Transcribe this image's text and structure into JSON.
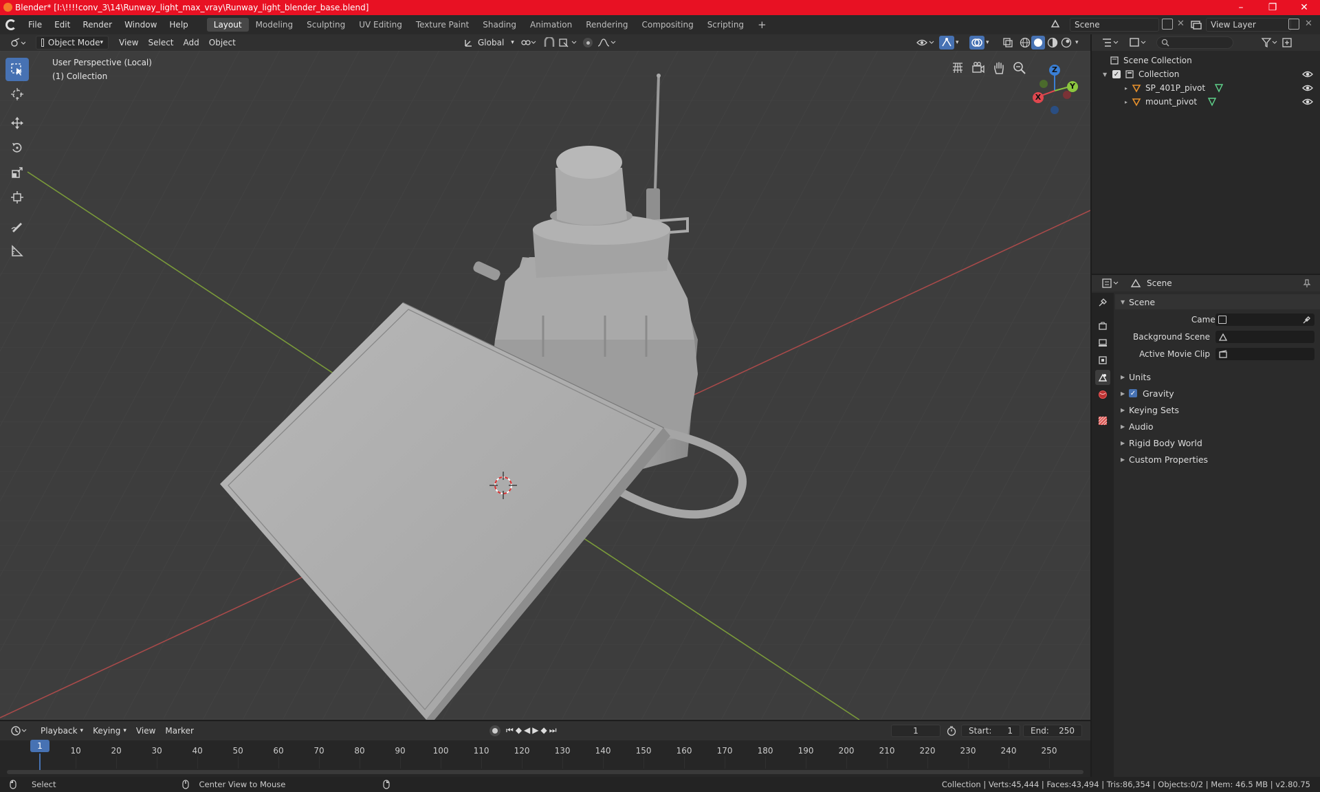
{
  "window": {
    "title": "Blender* [I:\\!!!!conv_3\\14\\Runway_light_max_vray\\Runway_light_blender_base.blend]",
    "minimize": "–",
    "maximize": "❐",
    "close": "✕"
  },
  "menu": [
    "File",
    "Edit",
    "Render",
    "Window",
    "Help"
  ],
  "workspaces": [
    "Layout",
    "Modeling",
    "Sculpting",
    "UV Editing",
    "Texture Paint",
    "Shading",
    "Animation",
    "Rendering",
    "Compositing",
    "Scripting"
  ],
  "workspace_add": "+",
  "scene_selector": {
    "scene": "Scene",
    "view_layer": "View Layer"
  },
  "viewport_header": {
    "mode": "Object Mode",
    "menus": [
      "View",
      "Select",
      "Add",
      "Object"
    ],
    "orientation": "Global"
  },
  "viewport": {
    "perspective": "User Perspective (Local)",
    "collection": "(1) Collection",
    "gizmo": {
      "x": "X",
      "y": "Y",
      "z": "Z"
    }
  },
  "outliner": {
    "root": "Scene Collection",
    "collection": "Collection",
    "objects": [
      "SP_401P_pivot",
      "mount_pivot"
    ]
  },
  "properties": {
    "context": "Scene",
    "panel": "Scene",
    "fields": [
      {
        "label": "Camera"
      },
      {
        "label": "Background Scene"
      },
      {
        "label": "Active Movie Clip"
      }
    ],
    "subpanels": [
      "Units",
      "Gravity",
      "Keying Sets",
      "Audio",
      "Rigid Body World",
      "Custom Properties"
    ],
    "gravity_checked": true
  },
  "timeline": {
    "menus": [
      "Playback",
      "Keying",
      "View",
      "Marker"
    ],
    "current_frame": "1",
    "start_label": "Start:",
    "start": "1",
    "end_label": "End:",
    "end": "250",
    "ticks": [
      "1",
      "10",
      "20",
      "30",
      "40",
      "50",
      "60",
      "70",
      "80",
      "90",
      "100",
      "110",
      "120",
      "130",
      "140",
      "150",
      "160",
      "170",
      "180",
      "190",
      "200",
      "210",
      "220",
      "230",
      "240",
      "250"
    ]
  },
  "statusbar": {
    "select": "Select",
    "center": "Center View to Mouse",
    "stats": "Collection | Verts:45,444 | Faces:43,494 | Tris:86,354 | Objects:0/2 | Mem: 46.5 MB | v2.80.75"
  },
  "colors": {
    "titlebar": "#e81123",
    "accent": "#4772b3",
    "x_axis": "#e0474e",
    "y_axis": "#8cc63f",
    "z_axis": "#3a7fd5"
  }
}
